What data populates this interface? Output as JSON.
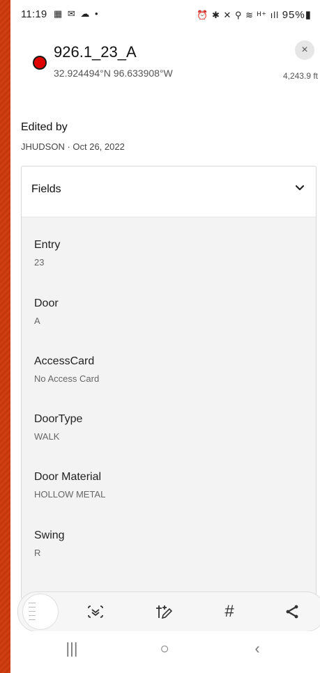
{
  "status_bar": {
    "time": "11:19",
    "left_icons": "▦ ✉ ☁ •",
    "right_icons": "⏰ ✱ ✕ ⚲ ≋ ᴴ⁺ ıll",
    "battery": "95%▮"
  },
  "feature": {
    "title": "926.1_23_A",
    "coordinates": "32.924494°N 96.633908°W",
    "distance": "4,243.9 ft",
    "close_icon": "×",
    "marker_color": "#e00000"
  },
  "edited": {
    "label": "Edited by",
    "value": "JHUDSON · Oct 26, 2022"
  },
  "fields_section": {
    "header": "Fields",
    "fields": [
      {
        "label": "Entry",
        "value": "23"
      },
      {
        "label": "Door",
        "value": "A"
      },
      {
        "label": "AccessCard",
        "value": "No Access Card"
      },
      {
        "label": "DoorType",
        "value": "WALK"
      },
      {
        "label": "Door Material",
        "value": "HOLLOW METAL"
      },
      {
        "label": "Swing",
        "value": "R"
      }
    ]
  },
  "toolbar": {
    "buttons": [
      {
        "name": "scan-icon",
        "glyph": "⟪⟫"
      },
      {
        "name": "edit-attribute-icon",
        "glyph": "✎"
      },
      {
        "name": "hash-icon",
        "glyph": "#"
      },
      {
        "name": "share-icon",
        "glyph": "<"
      }
    ]
  },
  "nav_bar": {
    "recents": "|||",
    "home": "○",
    "back": "‹"
  }
}
